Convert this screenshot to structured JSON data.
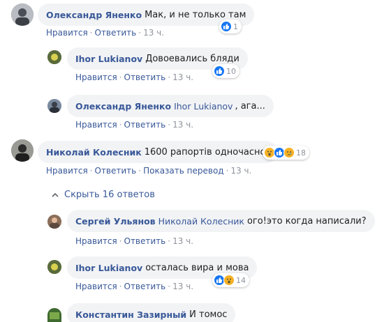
{
  "comments": [
    {
      "author": "Олександр Яненко",
      "mention": "",
      "text": "Мак, и не только там",
      "actions": [
        "Нравится",
        "Ответить"
      ],
      "time": "13 ч.",
      "reactions": "1"
    },
    {
      "author": "Ihor Lukianov",
      "mention": "",
      "text": "Довоевались бляди",
      "actions": [
        "Нравится",
        "Ответить"
      ],
      "time": "13 ч.",
      "reactions": "10"
    },
    {
      "author": "Олександр Яненко",
      "mention": "Ihor Lukianov",
      "text": ", ага...",
      "actions": [
        "Нравится",
        "Ответить"
      ],
      "time": "13 ч."
    },
    {
      "author": "Николай Колесник",
      "mention": "",
      "text": "1600 рапортів одночасно.",
      "actions": [
        "Нравится",
        "Ответить",
        "Показать перевод"
      ],
      "time": "13 ч.",
      "reactions": "18"
    },
    {
      "author": "Сергей Ульянов",
      "mention": "Николай Колесник",
      "text": "ого!это когда написали?",
      "actions": [
        "Нравится",
        "Ответить"
      ],
      "time": "13 ч."
    },
    {
      "author": "Ihor Lukianov",
      "mention": "",
      "text": "осталась вира и мова",
      "actions": [
        "Нравится",
        "Ответить"
      ],
      "time": "13 ч.",
      "reactions": "14"
    },
    {
      "author": "Константин Зазирный",
      "mention": "",
      "text": "И томос"
    }
  ],
  "toggle": {
    "label": "Скрыть 16 ответов"
  },
  "icons": {
    "like": "like-reaction-icon",
    "wow": "wow-reaction-icon",
    "sad": "sad-reaction-icon",
    "chevron": "chevron-up-icon"
  },
  "colors": {
    "link": "#385898",
    "bubble": "#f2f3f5",
    "like": "#1877f2",
    "wow": "#f7b125"
  }
}
